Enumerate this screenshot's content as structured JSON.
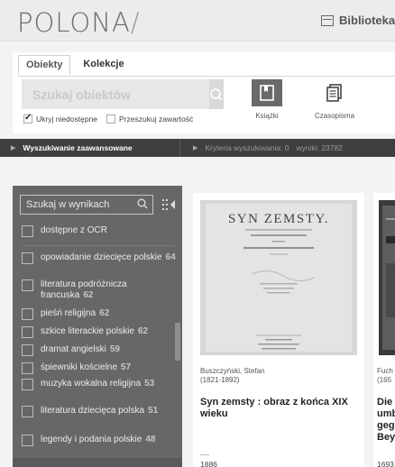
{
  "header": {
    "logo": "POLONA",
    "logo_slash": "/",
    "library_label": "Biblioteka"
  },
  "search": {
    "tabs": [
      "Obiekty",
      "Kolekcje"
    ],
    "placeholder": "Szukaj obiektów",
    "types": [
      "Książki",
      "Czasopisma"
    ],
    "options": [
      {
        "label": "Ukryj niedostępne",
        "checked": true
      },
      {
        "label": "Przeszukuj zawartość",
        "checked": false
      }
    ]
  },
  "advanced": {
    "label": "Wyszukiwanie zaawansowane",
    "criteria": "Kryteria wyszukiwania: 0",
    "results": "wyniki: 23782"
  },
  "sidebar": {
    "search_placeholder": "Szukaj w wynikach",
    "facets": [
      {
        "label": "dostępne z OCR",
        "count": ""
      },
      {
        "label": "opowiadanie dziecięce polskie",
        "count": "64"
      },
      {
        "label": "literatura podróżnicza francuska",
        "count": "62"
      },
      {
        "label": "pieśń religijna",
        "count": "62"
      },
      {
        "label": "szkice literackie polskie",
        "count": "62"
      },
      {
        "label": "dramat angielski",
        "count": "59"
      },
      {
        "label": "śpiewniki kościelne",
        "count": "57"
      },
      {
        "label": "muzyka wokalna religijna",
        "count": "53"
      },
      {
        "label": "literatura dziecięca polska",
        "count": "51"
      },
      {
        "label": "legendy i podania polskie",
        "count": "48"
      }
    ]
  },
  "results": [
    {
      "thumb_title": "SYN ZEMSTY.",
      "author": "Buszczyński, Stefan",
      "dates": "(1821-1892)",
      "title": "Syn zemsty : obraz z końca XIX wieku",
      "year": "1886"
    },
    {
      "author": "Fuch",
      "dates": "(165",
      "title_lines": [
        "Die",
        "umb",
        "geg",
        "Bey"
      ],
      "year": "1693"
    }
  ]
}
